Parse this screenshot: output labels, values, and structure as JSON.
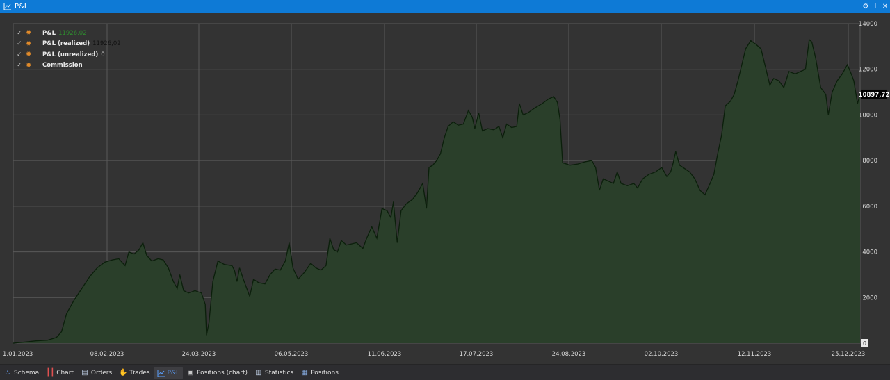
{
  "window": {
    "title": "P&L"
  },
  "legend": [
    {
      "label": "P&L",
      "value": "11926,02",
      "value_color": "#2e8b2e"
    },
    {
      "label": "P&L (realized)",
      "value": "11926,02",
      "value_color": "#111111"
    },
    {
      "label": "P&L (unrealized)",
      "value": "0",
      "value_color": "#dddddd"
    },
    {
      "label": "Commission",
      "value": "",
      "value_color": "#dddddd"
    }
  ],
  "current_value_label": "10897,72",
  "zero_marker": "0",
  "tabs": [
    {
      "label": "Schema",
      "icon": "schema-icon",
      "active": false
    },
    {
      "label": "Chart",
      "icon": "candlestick-icon",
      "active": false
    },
    {
      "label": "Orders",
      "icon": "document-icon",
      "active": false
    },
    {
      "label": "Trades",
      "icon": "handshake-icon",
      "active": false
    },
    {
      "label": "P&L",
      "icon": "line-chart-icon",
      "active": true
    },
    {
      "label": "Positions (chart)",
      "icon": "briefcase-icon",
      "active": false
    },
    {
      "label": "Statistics",
      "icon": "statistics-icon",
      "active": false
    },
    {
      "label": "Positions",
      "icon": "positions-icon",
      "active": false
    }
  ],
  "chart_data": {
    "type": "area",
    "x_ticks": [
      "1.01.2023",
      "08.02.2023",
      "24.03.2023",
      "06.05.2023",
      "11.06.2023",
      "17.07.2023",
      "24.08.2023",
      "02.10.2023",
      "12.11.2023",
      "25.12.2023"
    ],
    "y_ticks": [
      2000,
      4000,
      6000,
      8000,
      10000,
      12000,
      14000
    ],
    "ylim": [
      0,
      14000
    ],
    "colors": {
      "line": "#0b1f0b",
      "fill": "#2a3f2a",
      "grid": "#5a5a5a"
    },
    "series": [
      {
        "values": [
          [
            0,
            0
          ],
          [
            9,
            50
          ],
          [
            18,
            100
          ],
          [
            27,
            130
          ],
          [
            34,
            250
          ],
          [
            38,
            500
          ],
          [
            42,
            1300
          ],
          [
            48,
            1900
          ],
          [
            54,
            2400
          ],
          [
            60,
            2900
          ],
          [
            66,
            3300
          ],
          [
            72,
            3550
          ],
          [
            78,
            3650
          ],
          [
            83,
            3700
          ],
          [
            88,
            3400
          ],
          [
            91,
            4000
          ],
          [
            95,
            3900
          ],
          [
            99,
            4100
          ],
          [
            102,
            4400
          ],
          [
            105,
            3850
          ],
          [
            109,
            3600
          ],
          [
            114,
            3700
          ],
          [
            118,
            3650
          ],
          [
            122,
            3300
          ],
          [
            126,
            2700
          ],
          [
            129,
            2400
          ],
          [
            131,
            3000
          ],
          [
            134,
            2300
          ],
          [
            138,
            2200
          ],
          [
            143,
            2300
          ],
          [
            148,
            2200
          ],
          [
            151,
            1700
          ],
          [
            152,
            350
          ],
          [
            154,
            900
          ],
          [
            157,
            2700
          ],
          [
            161,
            3600
          ],
          [
            166,
            3450
          ],
          [
            172,
            3400
          ],
          [
            174,
            3200
          ],
          [
            176,
            2700
          ],
          [
            178,
            3300
          ],
          [
            181,
            2800
          ],
          [
            186,
            2050
          ],
          [
            189,
            2800
          ],
          [
            193,
            2650
          ],
          [
            198,
            2600
          ],
          [
            202,
            3000
          ],
          [
            206,
            3250
          ],
          [
            210,
            3200
          ],
          [
            214,
            3600
          ],
          [
            217,
            4400
          ],
          [
            220,
            3300
          ],
          [
            224,
            2800
          ],
          [
            229,
            3100
          ],
          [
            234,
            3500
          ],
          [
            238,
            3300
          ],
          [
            242,
            3200
          ],
          [
            246,
            3400
          ],
          [
            249,
            4600
          ],
          [
            252,
            4100
          ],
          [
            255,
            4000
          ],
          [
            258,
            4500
          ],
          [
            262,
            4300
          ],
          [
            266,
            4350
          ],
          [
            270,
            4400
          ],
          [
            275,
            4150
          ],
          [
            278,
            4600
          ],
          [
            282,
            5100
          ],
          [
            286,
            4600
          ],
          [
            290,
            5900
          ],
          [
            294,
            5800
          ],
          [
            297,
            5500
          ],
          [
            299,
            6200
          ],
          [
            302,
            4400
          ],
          [
            305,
            5800
          ],
          [
            309,
            6100
          ],
          [
            314,
            6300
          ],
          [
            318,
            6600
          ],
          [
            322,
            7000
          ],
          [
            325,
            5900
          ],
          [
            327,
            7700
          ],
          [
            330,
            7800
          ],
          [
            333,
            8000
          ],
          [
            336,
            8300
          ],
          [
            339,
            9000
          ],
          [
            342,
            9500
          ],
          [
            346,
            9700
          ],
          [
            350,
            9550
          ],
          [
            354,
            9600
          ],
          [
            358,
            10200
          ],
          [
            361,
            9900
          ],
          [
            363,
            9400
          ],
          [
            366,
            10100
          ],
          [
            369,
            9300
          ],
          [
            373,
            9400
          ],
          [
            378,
            9350
          ],
          [
            382,
            9500
          ],
          [
            385,
            9000
          ],
          [
            388,
            9600
          ],
          [
            392,
            9450
          ],
          [
            396,
            9500
          ],
          [
            398,
            10500
          ],
          [
            401,
            10000
          ],
          [
            405,
            10100
          ],
          [
            410,
            10300
          ],
          [
            416,
            10500
          ],
          [
            421,
            10700
          ],
          [
            425,
            10800
          ],
          [
            428,
            10550
          ],
          [
            430,
            9800
          ],
          [
            432,
            7900
          ],
          [
            438,
            7800
          ],
          [
            444,
            7850
          ],
          [
            450,
            7950
          ],
          [
            455,
            8000
          ],
          [
            458,
            7700
          ],
          [
            461,
            6700
          ],
          [
            464,
            7200
          ],
          [
            468,
            7100
          ],
          [
            472,
            7000
          ],
          [
            475,
            7500
          ],
          [
            478,
            7000
          ],
          [
            483,
            6900
          ],
          [
            488,
            7000
          ],
          [
            491,
            6800
          ],
          [
            495,
            7200
          ],
          [
            500,
            7400
          ],
          [
            505,
            7500
          ],
          [
            510,
            7700
          ],
          [
            514,
            7300
          ],
          [
            517,
            7500
          ],
          [
            519,
            7900
          ],
          [
            521,
            8400
          ],
          [
            524,
            7800
          ],
          [
            528,
            7650
          ],
          [
            532,
            7500
          ],
          [
            536,
            7200
          ],
          [
            540,
            6700
          ],
          [
            544,
            6500
          ],
          [
            548,
            7000
          ],
          [
            551,
            7400
          ],
          [
            554,
            8300
          ],
          [
            557,
            9100
          ],
          [
            560,
            10400
          ],
          [
            564,
            10600
          ],
          [
            567,
            10900
          ],
          [
            570,
            11500
          ],
          [
            573,
            12200
          ],
          [
            576,
            12900
          ],
          [
            580,
            13250
          ],
          [
            584,
            13100
          ],
          [
            588,
            12900
          ],
          [
            592,
            12000
          ],
          [
            595,
            11300
          ],
          [
            598,
            11600
          ],
          [
            602,
            11500
          ],
          [
            606,
            11200
          ],
          [
            610,
            11900
          ],
          [
            615,
            11800
          ],
          [
            619,
            11900
          ],
          [
            623,
            12000
          ],
          [
            626,
            13300
          ],
          [
            628,
            13200
          ],
          [
            631,
            12500
          ],
          [
            635,
            11200
          ],
          [
            639,
            10900
          ],
          [
            641,
            10000
          ],
          [
            644,
            11000
          ],
          [
            648,
            11500
          ],
          [
            652,
            11800
          ],
          [
            656,
            12200
          ],
          [
            659,
            11800
          ],
          [
            661,
            11500
          ],
          [
            664,
            10500
          ],
          [
            666,
            10897.72
          ]
        ]
      }
    ]
  }
}
